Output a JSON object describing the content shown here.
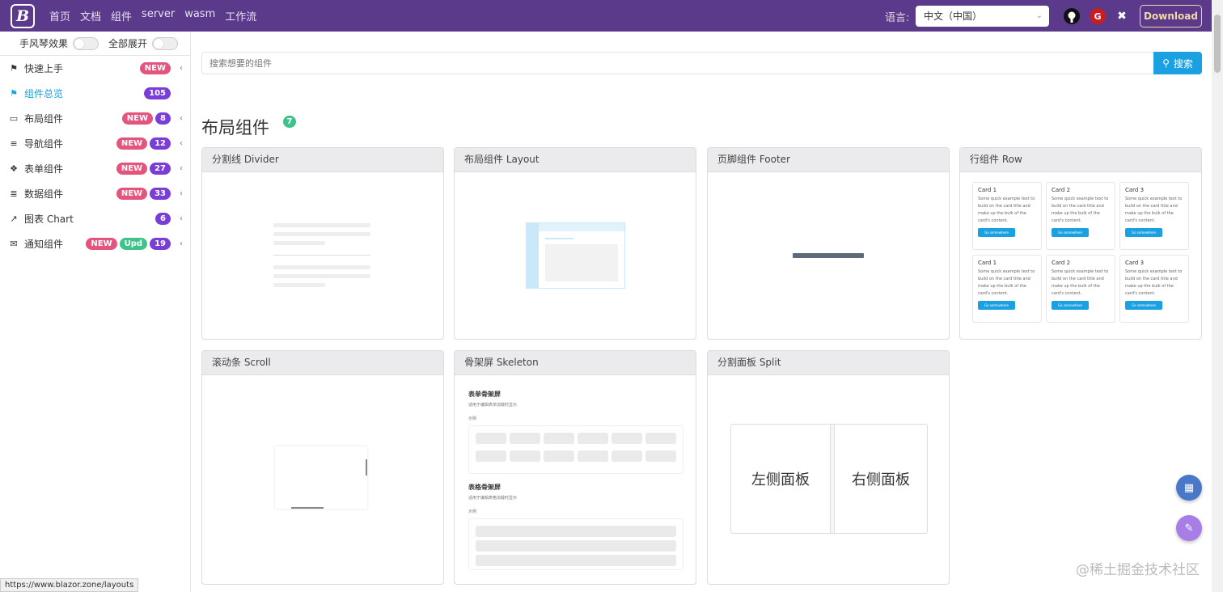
{
  "header": {
    "logo": "B",
    "nav": [
      "首页",
      "文档",
      "组件",
      "server",
      "wasm",
      "工作流"
    ],
    "lang_label": "语言:",
    "lang_value": "中文（中国）",
    "gitee_glyph": "G",
    "download": "Download"
  },
  "sidebar": {
    "accordion_label": "手风琴效果",
    "expand_label": "全部展开",
    "items": [
      {
        "label": "快速上手",
        "icon": "flag-icon",
        "glyph": "⚑",
        "badges": [
          {
            "text": "NEW",
            "kind": "new"
          }
        ]
      },
      {
        "label": "组件总览",
        "icon": "flag-icon",
        "glyph": "⚑",
        "active": true,
        "badges": [
          {
            "text": "105",
            "kind": "num"
          }
        ]
      },
      {
        "label": "布局组件",
        "icon": "desktop-icon",
        "glyph": "▭",
        "badges": [
          {
            "text": "NEW",
            "kind": "new"
          },
          {
            "text": "8",
            "kind": "num"
          }
        ]
      },
      {
        "label": "导航组件",
        "icon": "list-icon",
        "glyph": "≡",
        "badges": [
          {
            "text": "NEW",
            "kind": "new"
          },
          {
            "text": "12",
            "kind": "num"
          }
        ]
      },
      {
        "label": "表单组件",
        "icon": "cubes-icon",
        "glyph": "❖",
        "badges": [
          {
            "text": "NEW",
            "kind": "new"
          },
          {
            "text": "27",
            "kind": "num"
          }
        ]
      },
      {
        "label": "数据组件",
        "icon": "database-icon",
        "glyph": "≣",
        "badges": [
          {
            "text": "NEW",
            "kind": "new"
          },
          {
            "text": "33",
            "kind": "num"
          }
        ]
      },
      {
        "label": "图表 Chart",
        "icon": "chart-icon",
        "glyph": "↗",
        "badges": [
          {
            "text": "6",
            "kind": "num"
          }
        ]
      },
      {
        "label": "通知组件",
        "icon": "comments-icon",
        "glyph": "✉",
        "badges": [
          {
            "text": "NEW",
            "kind": "new"
          },
          {
            "text": "Upd",
            "kind": "upd"
          },
          {
            "text": "19",
            "kind": "num"
          }
        ]
      }
    ]
  },
  "search": {
    "placeholder": "搜索想要的组件",
    "button": "搜索"
  },
  "section": {
    "title": "布局组件",
    "count": "7"
  },
  "cards": [
    {
      "title": "分割线 Divider"
    },
    {
      "title": "布局组件 Layout"
    },
    {
      "title": "页脚组件 Footer"
    },
    {
      "title": "行组件 Row"
    },
    {
      "title": "滚动条 Scroll"
    },
    {
      "title": "骨架屏 Skeleton"
    },
    {
      "title": "分割面板 Split"
    }
  ],
  "row_preview": {
    "cards": [
      "Card 1",
      "Card 2",
      "Card 3",
      "Card 1",
      "Card 2",
      "Card 3"
    ],
    "text": "Some quick example text to build on the card title and make up the bulk of the card's content.",
    "button": "Go somewhere"
  },
  "skeleton_preview": {
    "form_title": "表单骨架屏",
    "form_desc": "适用于编辑表单加载时显示",
    "example1": "示例",
    "table_title": "表格骨架屏",
    "table_desc": "适用于编辑表格加载时显示",
    "example2": "示例"
  },
  "split_preview": {
    "left": "左侧面板",
    "right": "右侧面板"
  },
  "watermark": "@稀土掘金技术社区",
  "status_url": "https://www.blazor.zone/layouts",
  "colors": {
    "header_bg": "#5b3a8c",
    "accent": "#1ba1e2",
    "badge_new": "#e5547d",
    "badge_upd": "#3ec48b",
    "badge_num": "#7a3ed6"
  }
}
